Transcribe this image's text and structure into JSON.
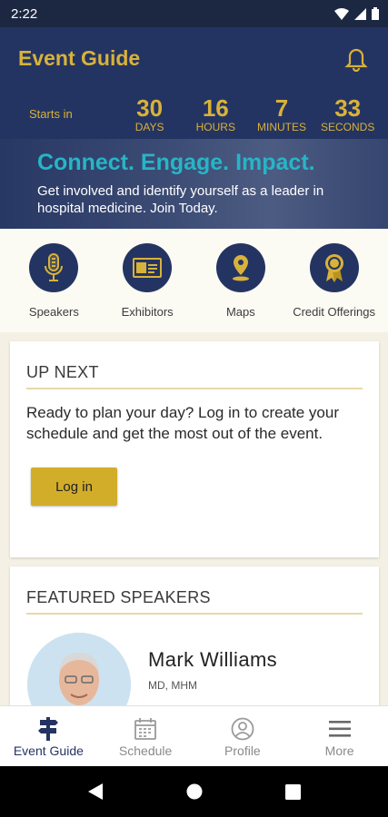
{
  "status": {
    "time": "2:22"
  },
  "app": {
    "title": "Event Guide"
  },
  "countdown": {
    "label": "Starts in",
    "units": [
      {
        "value": "30",
        "label": "DAYS"
      },
      {
        "value": "16",
        "label": "HOURS"
      },
      {
        "value": "7",
        "label": "MINUTES"
      },
      {
        "value": "33",
        "label": "SECONDS"
      }
    ]
  },
  "banner": {
    "headline": "Connect. Engage. Impact.",
    "subtext": "Get involved and identify yourself as a leader in hospital medicine. Join Today."
  },
  "quick_links": [
    {
      "label": "Speakers",
      "icon": "microphone-icon"
    },
    {
      "label": "Exhibitors",
      "icon": "id-card-icon"
    },
    {
      "label": "Maps",
      "icon": "map-pin-icon"
    },
    {
      "label": "Credit Offerings",
      "icon": "award-ribbon-icon"
    }
  ],
  "up_next": {
    "title": "UP NEXT",
    "body": "Ready to plan your day? Log in to create your schedule and get the most out of the event.",
    "button_label": "Log in"
  },
  "featured_speakers": {
    "title": "FEATURED SPEAKERS",
    "speakers": [
      {
        "name": "Mark Williams",
        "credentials": "MD, MHM"
      }
    ]
  },
  "bottom_nav": [
    {
      "label": "Event Guide",
      "icon": "signpost-icon",
      "active": true
    },
    {
      "label": "Schedule",
      "icon": "calendar-icon",
      "active": false
    },
    {
      "label": "Profile",
      "icon": "profile-icon",
      "active": false
    },
    {
      "label": "More",
      "icon": "menu-icon",
      "active": false
    }
  ],
  "colors": {
    "navy": "#243462",
    "gold": "#d8b23a",
    "teal": "#26b5c7",
    "button": "#d2ad2a"
  }
}
